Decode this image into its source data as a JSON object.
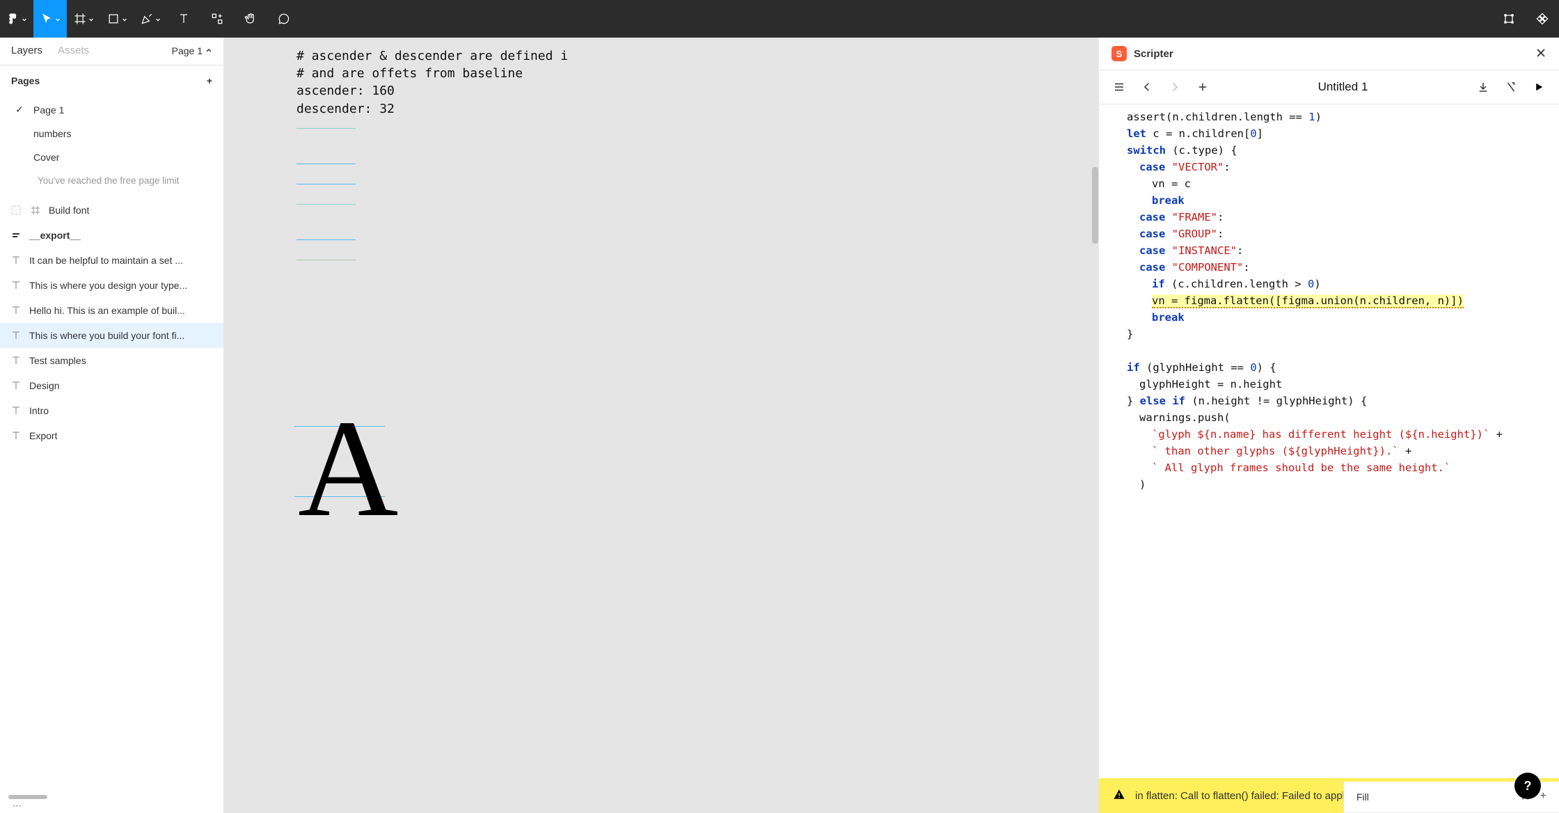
{
  "toolbar": {
    "icons": [
      "figma-logo",
      "move-tool",
      "frame-tool",
      "rect-tool",
      "pen-tool",
      "text-tool",
      "resources-tool",
      "hand-tool",
      "comment-tool"
    ],
    "right_icons": [
      "align-tool",
      "boolean-tool"
    ]
  },
  "sidebar": {
    "tabs": {
      "layers": "Layers",
      "assets": "Assets"
    },
    "page_selector": "Page 1",
    "pages_header": "Pages",
    "pages": [
      {
        "name": "Page 1",
        "checked": true
      },
      {
        "name": "numbers"
      },
      {
        "name": "Cover"
      },
      {
        "name": "You've reached the free page limit",
        "dim": true
      }
    ],
    "layers": [
      {
        "icon": "frame",
        "text": "Build font",
        "extra": "dashed"
      },
      {
        "icon": "component",
        "text": "__export__",
        "bold": true
      },
      {
        "icon": "text",
        "text": "It can be helpful to maintain a set ..."
      },
      {
        "icon": "text",
        "text": "This is where you design your type..."
      },
      {
        "icon": "text",
        "text": "Hello hi. This is an example of buil..."
      },
      {
        "icon": "text",
        "text": "This is where you build your font fi...",
        "selected": true
      },
      {
        "icon": "text",
        "text": "Test samples"
      },
      {
        "icon": "text",
        "text": "Design"
      },
      {
        "icon": "text",
        "text": "Intro"
      },
      {
        "icon": "text",
        "text": "Export"
      }
    ]
  },
  "canvas": {
    "lines": [
      "# ascender & descender are defined i",
      "# and are offets from baseline",
      "ascender: 160",
      "descender: 32"
    ],
    "glyph": "A"
  },
  "scripter": {
    "title": "Scripter",
    "doc_title": "Untitled 1",
    "code_lines": [
      {
        "indent": 0,
        "html": "assert(n.children.length == <span class='num'>1</span>)"
      },
      {
        "indent": 0,
        "html": "<span class='kw'>let</span> c = n.children[<span class='num'>0</span>]"
      },
      {
        "indent": 0,
        "html": "<span class='kw'>switch</span> (c.type) {"
      },
      {
        "indent": 1,
        "html": "<span class='kw'>case</span> <span class='str'>\"VECTOR\"</span>:"
      },
      {
        "indent": 2,
        "html": "vn = c"
      },
      {
        "indent": 2,
        "html": "<span class='kw'>break</span>"
      },
      {
        "indent": 1,
        "html": "<span class='kw'>case</span> <span class='str'>\"FRAME\"</span>:"
      },
      {
        "indent": 1,
        "html": "<span class='kw'>case</span> <span class='str'>\"GROUP\"</span>:"
      },
      {
        "indent": 1,
        "html": "<span class='kw'>case</span> <span class='str'>\"INSTANCE\"</span>:"
      },
      {
        "indent": 1,
        "html": "<span class='kw'>case</span> <span class='str'>\"COMPONENT\"</span>:"
      },
      {
        "indent": 2,
        "html": "<span class='kw'>if</span> (c.children.length &gt; <span class='num'>0</span>)"
      },
      {
        "indent": 2,
        "html": "<span class='hl'>vn = figma.flatten([figma.union(n.children, n)])</span>"
      },
      {
        "indent": 2,
        "html": "<span class='kw'>break</span>"
      },
      {
        "indent": 0,
        "html": "}"
      },
      {
        "indent": 0,
        "html": "&nbsp;"
      },
      {
        "indent": 0,
        "html": "<span class='kw'>if</span> (glyphHeight == <span class='num'>0</span>) {"
      },
      {
        "indent": 1,
        "html": "glyphHeight = n.height"
      },
      {
        "indent": 0,
        "html": "} <span class='kw'>else if</span> (n.height != glyphHeight) {"
      },
      {
        "indent": 1,
        "html": "warnings.push("
      },
      {
        "indent": 2,
        "html": "<span class='tpl'>`glyph ${n.name} has different height (${n.height})`</span> +"
      },
      {
        "indent": 2,
        "html": "<span class='tpl'>` than other glyphs (${glyphHeight}).`</span> +"
      },
      {
        "indent": 2,
        "html": "<span class='tpl'>` All glyph frames should be the same height.`</span>"
      },
      {
        "indent": 1,
        "html": ")"
      }
    ],
    "error": "in flatten: Call to flatten() failed: Failed to apply flatten operation"
  },
  "inspector": {
    "fill_label": "Fill"
  },
  "help": "?"
}
